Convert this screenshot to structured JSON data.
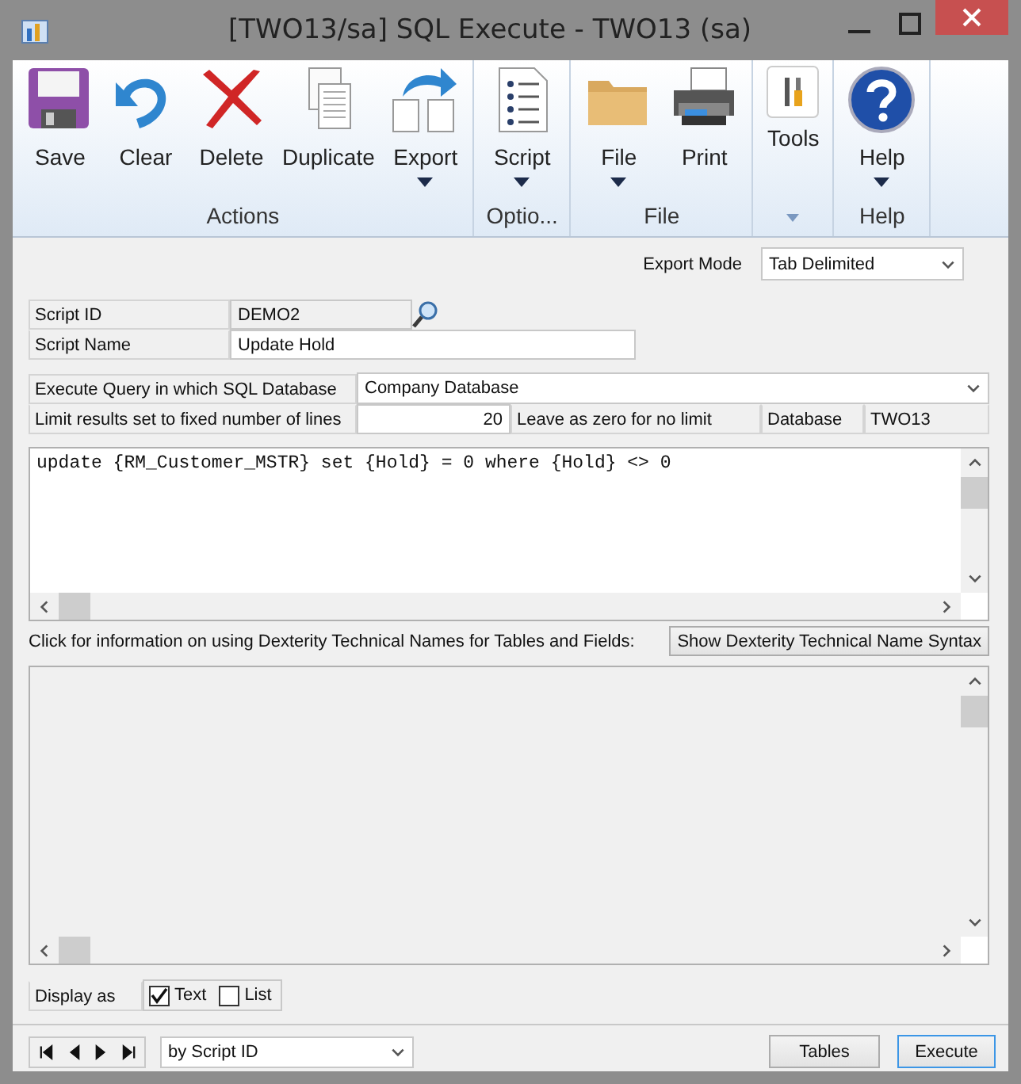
{
  "window": {
    "title": "[TWO13/sa] SQL Execute  -  TWO13 (sa)"
  },
  "ribbon": {
    "groups": [
      {
        "label": "Actions",
        "buttons": [
          {
            "label": "Save",
            "kind": "save",
            "dropdown": false
          },
          {
            "label": "Clear",
            "kind": "clear",
            "dropdown": false
          },
          {
            "label": "Delete",
            "kind": "delete",
            "dropdown": false
          },
          {
            "label": "Duplicate",
            "kind": "duplicate",
            "dropdown": false
          },
          {
            "label": "Export",
            "kind": "export",
            "dropdown": true
          }
        ]
      },
      {
        "label": "Optio...",
        "buttons": [
          {
            "label": "Script",
            "kind": "script",
            "dropdown": true
          }
        ]
      },
      {
        "label": "File",
        "buttons": [
          {
            "label": "File",
            "kind": "folder",
            "dropdown": true
          },
          {
            "label": "Print",
            "kind": "print",
            "dropdown": false
          }
        ]
      },
      {
        "buttons": [
          {
            "label": "Tools",
            "kind": "tools",
            "dropdown": false
          }
        ]
      },
      {
        "label": "Help",
        "buttons": [
          {
            "label": "Help",
            "kind": "help",
            "dropdown": true
          }
        ]
      }
    ]
  },
  "export_mode": {
    "label": "Export Mode",
    "value": "Tab Delimited"
  },
  "script_id": {
    "label": "Script ID",
    "value": "DEMO2"
  },
  "script_name": {
    "label": "Script Name",
    "value": "Update Hold"
  },
  "execute_query": {
    "label": "Execute Query in which SQL Database",
    "value": "Company Database"
  },
  "limit": {
    "label": "Limit results set to fixed number of lines",
    "value": "20",
    "hint": "Leave as zero for no limit"
  },
  "database": {
    "label": "Database",
    "value": "TWO13"
  },
  "script_text": "update {RM_Customer_MSTR} set {Hold} = 0 where {Hold} <> 0",
  "info": {
    "text": "Click for information on using Dexterity Technical Names for Tables and Fields:",
    "button": "Show Dexterity Technical Name Syntax"
  },
  "display": {
    "label": "Display as",
    "options": [
      {
        "label": "Text",
        "checked": true
      },
      {
        "label": "List",
        "checked": false
      }
    ]
  },
  "sort": {
    "value": "by Script ID"
  },
  "buttons": [
    {
      "label": "Tables",
      "default": false
    },
    {
      "label": "Execute",
      "default": true
    }
  ]
}
